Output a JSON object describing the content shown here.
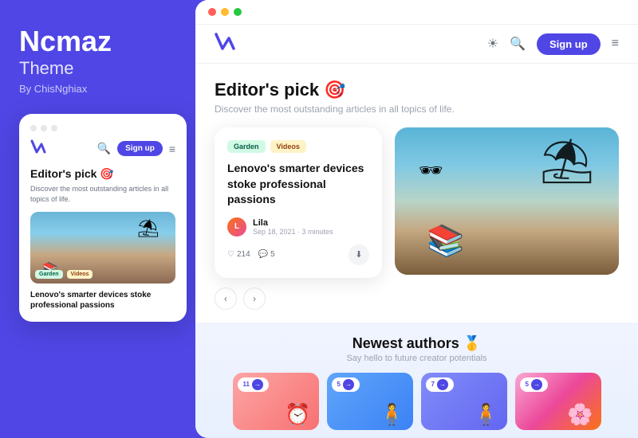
{
  "sidebar": {
    "title": "Ncmaz",
    "subtitle": "Theme",
    "byline": "By ChisNghiax"
  },
  "mobile": {
    "signup_label": "Sign up",
    "editors_pick": "Editor's pick 🎯",
    "description": "Discover the most outstanding articles in all topics of life.",
    "tag_garden": "Garden",
    "tag_videos": "Videos",
    "article_title": "Lenovo's smarter devices stoke professional passions"
  },
  "desktop": {
    "signup_label": "Sign up",
    "browser_dots": [
      "red",
      "yellow",
      "green"
    ],
    "editors_pick": "Editor's pick 🎯",
    "editors_pick_sub": "Discover the most outstanding articles in all topics of life.",
    "article": {
      "tag_garden": "Garden",
      "tag_videos": "Videos",
      "title": "Lenovo's smarter devices stoke professional passions",
      "author_name": "Lila",
      "author_date": "Sep 18, 2021 · 3 minutes",
      "likes": "214",
      "comments": "5"
    },
    "newest_authors": {
      "heading": "Newest authors 🥇",
      "subtitle": "Say hello to future creator potentials",
      "cards": [
        {
          "badge": "11",
          "emoji": "⏰"
        },
        {
          "badge": "5",
          "emoji": "🧍"
        },
        {
          "badge": "7",
          "emoji": "🧍"
        },
        {
          "badge": "5",
          "emoji": "🌸"
        }
      ]
    }
  },
  "icons": {
    "sun": "☀",
    "search": "🔍",
    "menu": "≡",
    "heart": "♡",
    "comment": "💬",
    "download": "⬇",
    "arrow_left": "‹",
    "arrow_right": "›",
    "arrow_small": "→"
  }
}
